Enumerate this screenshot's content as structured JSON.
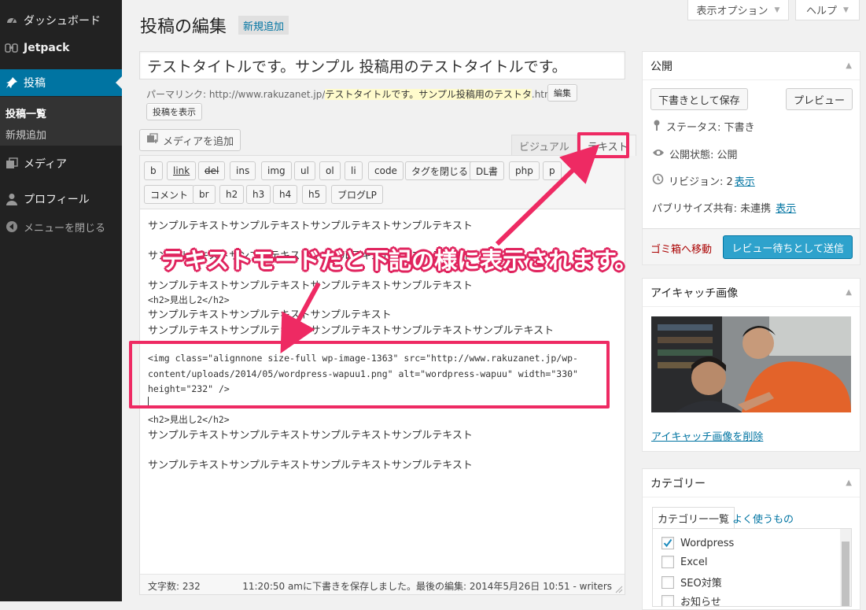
{
  "sidebar": {
    "items": [
      {
        "label": "ダッシュボード"
      },
      {
        "label": "Jetpack"
      },
      {
        "label": "投稿"
      },
      {
        "label": "メディア"
      },
      {
        "label": "プロフィール"
      },
      {
        "label": "メニューを閉じる"
      }
    ],
    "submenu": [
      {
        "label": "投稿一覧"
      },
      {
        "label": "新規追加"
      }
    ]
  },
  "screen_meta": {
    "options_label": "表示オプション",
    "help_label": "ヘルプ"
  },
  "header": {
    "title": "投稿の編集",
    "add_new": "新規追加"
  },
  "post": {
    "title": "テストタイトルです。サンプル 投稿用のテストタイトルです。",
    "permalink_label": "パーマリンク:",
    "permalink_base": "http://www.rakuzanet.jp/",
    "permalink_slug": "テストタイトルです。サンプル投稿用のテストタ",
    "permalink_ext": ".html",
    "edit_button": "編集",
    "view_button": "投稿を表示"
  },
  "editor": {
    "media_button": "メディアを追加",
    "tab_visual": "ビジュアル",
    "tab_text": "テキスト",
    "quicktags": [
      "b",
      "link",
      "del",
      "ins",
      "img",
      "ul",
      "ol",
      "li",
      "code",
      "タグを閉じる",
      "DL書",
      "php",
      "p",
      "コメント",
      "br",
      "h2",
      "h3",
      "h4",
      "h5",
      "ブログLP"
    ],
    "content_lines": [
      "サンプルテキストサンプルテキストサンプルテキストサンプルテキスト",
      "サンプルテキストサンプルテキストサンプルテキストサンプルテキスト",
      "サンプルテキストサンプルテキストサンプルテキストサンプルテキスト",
      "<h2>見出し2</h2>",
      "サンプルテキストサンプルテキストサンプルテキスト",
      "サンプルテキストサンプルテキストサンプルテキストサンプルテキストサンプルテキスト",
      "<img class=\"alignnone size-full wp-image-1363\" src=\"http://www.rakuzanet.jp/wp-",
      "content/uploads/2014/05/wordpress-wapuu1.png\" alt=\"wordpress-wapuu\" width=\"330\"",
      "height=\"232\" />",
      "<h2>見出し2</h2>",
      "サンプルテキストサンプルテキストサンプルテキストサンプルテキスト",
      "サンプルテキストサンプルテキストサンプルテキストサンプルテキスト"
    ],
    "word_count": "文字数: 232",
    "autosave_status": "11:20:50 amに下書きを保存しました。最後の編集: 2014年5月26日 10:51 - writers"
  },
  "annotation": {
    "text": "テキストモードだと下記の様に表示されます。",
    "color": "#ee2a63"
  },
  "publish_box": {
    "title": "公開",
    "save_draft": "下書きとして保存",
    "preview": "プレビュー",
    "status": "ステータス: 下書き",
    "visibility": "公開状態: 公開",
    "revisions_label": "リビジョン: 2",
    "revisions_link": "表示",
    "publicize_label": "パブリサイズ共有: 未連携",
    "publicize_link": "表示",
    "trash": "ゴミ箱へ移動",
    "submit": "レビュー待ちとして送信"
  },
  "featured_image_box": {
    "title": "アイキャッチ画像",
    "remove_link": "アイキャッチ画像を削除"
  },
  "category_box": {
    "title": "カテゴリー",
    "tab_all": "カテゴリー一覧",
    "tab_popular": "よく使うもの",
    "items": [
      {
        "label": "Wordpress",
        "checked": true
      },
      {
        "label": "Excel",
        "checked": false
      },
      {
        "label": "SEO対策",
        "checked": false
      },
      {
        "label": "お知らせ",
        "checked": false
      }
    ]
  },
  "colors": {
    "sidebar_bg": "#222222",
    "sidebar_active": "#0074a2",
    "primary_button": "#2ea2cc",
    "annotation": "#ee2a63",
    "link": "#0074a2",
    "trash": "#aa0000"
  }
}
